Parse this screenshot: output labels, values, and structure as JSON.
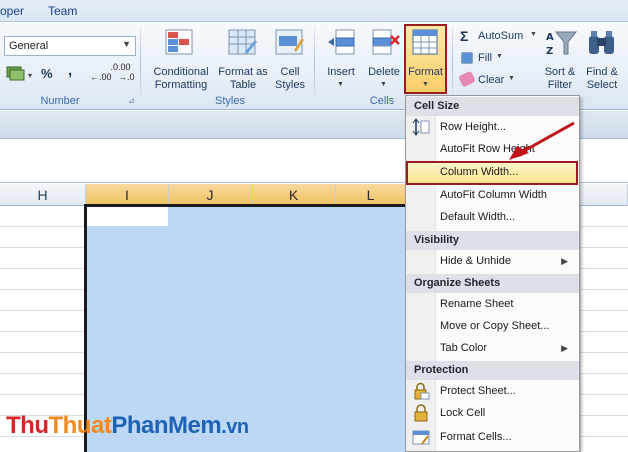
{
  "tabs": [
    "oper",
    "Team"
  ],
  "ribbon": {
    "number": {
      "format_value": "General",
      "currency_symbol": "$",
      "percent": "%",
      "comma": ",",
      "inc_decimal": "←.0 .00",
      "dec_decimal": ".00 →.0",
      "group_label": "Number"
    },
    "styles": {
      "conditional_formatting": "Conditional Formatting",
      "format_as_table": "Format as Table",
      "cell_styles": "Cell Styles",
      "group_label": "Styles"
    },
    "cells": {
      "insert": "Insert",
      "delete": "Delete",
      "format": "Format",
      "group_label": "Cells"
    },
    "editing": {
      "autosum": "AutoSum",
      "fill": "Fill",
      "clear": "Clear",
      "sort_filter": "Sort & Filter",
      "find_select": "Find & Select"
    }
  },
  "columns": [
    "H",
    "I",
    "J",
    "K",
    "L"
  ],
  "menu": {
    "cell_size_header": "Cell Size",
    "row_height": "Row Height...",
    "autofit_row_height": "AutoFit Row Height",
    "column_width": "Column Width...",
    "autofit_column_width": "AutoFit Column Width",
    "default_width": "Default Width...",
    "visibility_header": "Visibility",
    "hide_unhide": "Hide & Unhide",
    "organize_header": "Organize Sheets",
    "rename_sheet": "Rename Sheet",
    "move_copy_sheet": "Move or Copy Sheet...",
    "tab_color": "Tab Color",
    "protection_header": "Protection",
    "protect_sheet": "Protect Sheet...",
    "lock_cell": "Lock Cell",
    "format_cells": "Format Cells..."
  },
  "watermark": {
    "part1": "Thu",
    "part2": "Thuat",
    "part3": "PhanMem",
    "part4": ".vn"
  },
  "colors": {
    "highlight_border": "#9b1c1c",
    "arrow": "#c0161b",
    "selection": "#bcd8f5",
    "watermark_red": "#d7262b",
    "watermark_orange": "#f08a1e",
    "watermark_blue": "#1f63b5"
  }
}
